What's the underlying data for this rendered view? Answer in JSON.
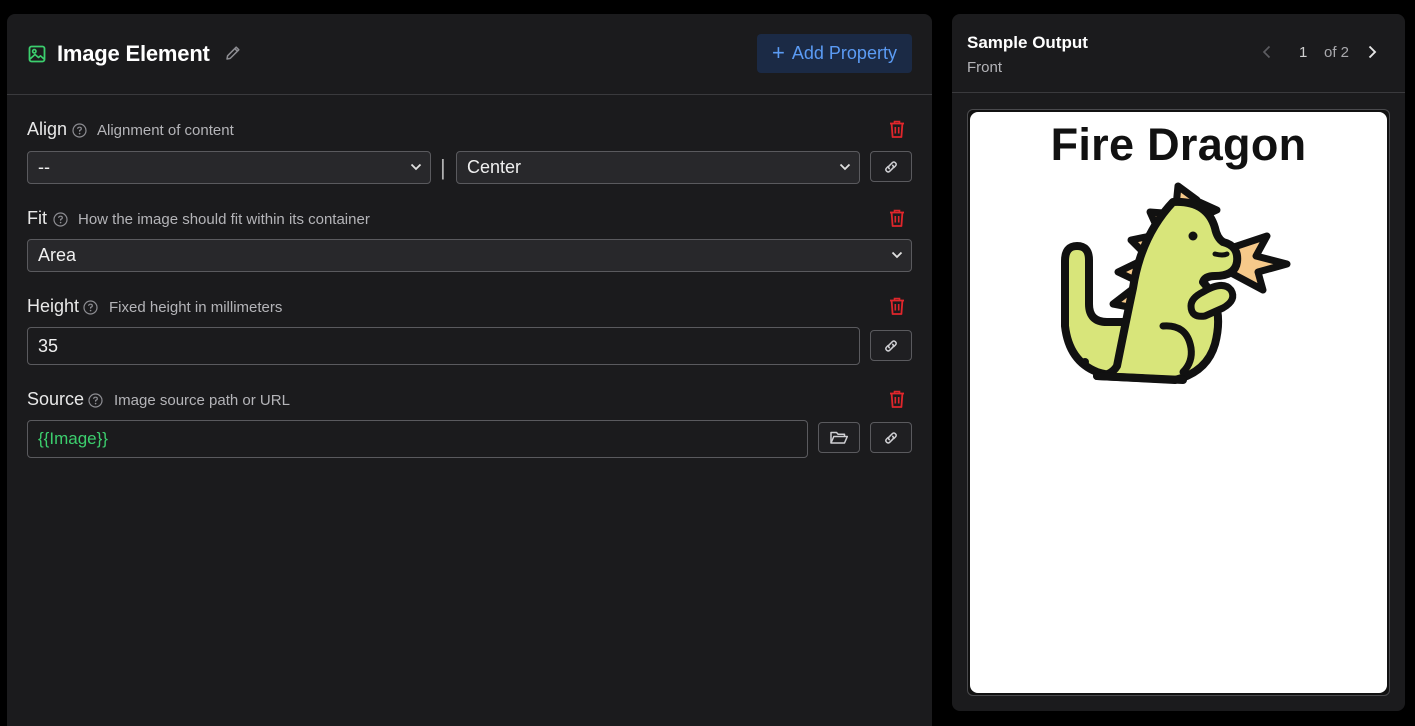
{
  "editor": {
    "title": "Image Element",
    "add_property_label": "Add Property",
    "properties": {
      "align": {
        "name": "Align",
        "description": "Alignment of content",
        "horizontal_value": "--",
        "separator": "|",
        "vertical_value": "Center"
      },
      "fit": {
        "name": "Fit",
        "description": "How the image should fit within its container",
        "value": "Area"
      },
      "height": {
        "name": "Height",
        "description": "Fixed height in millimeters",
        "value": "35"
      },
      "source": {
        "name": "Source",
        "description": "Image source path or URL",
        "value": "{{Image}}"
      }
    }
  },
  "preview": {
    "title": "Sample Output",
    "side": "Front",
    "page_current": "1",
    "page_total_label": "of 2",
    "card": {
      "title": "Fire Dragon",
      "image_icon": "green-dragon-icon"
    }
  },
  "icons": {
    "title": "image-icon",
    "edit": "pencil-icon",
    "help": "help-circle-icon",
    "delete": "trash-icon",
    "link": "link-icon",
    "folder": "folder-open-icon",
    "chevron": "chevron-down-icon",
    "prev": "chevron-left-icon",
    "next": "chevron-right-icon"
  },
  "colors": {
    "accent_blue": "#5b9bf4",
    "accent_green": "#3ccf6e",
    "delete_red": "#e0262b",
    "panel_bg": "#1b1b1d",
    "dragon_body": "#d8e57a",
    "dragon_spikes": "#f6c98a"
  }
}
